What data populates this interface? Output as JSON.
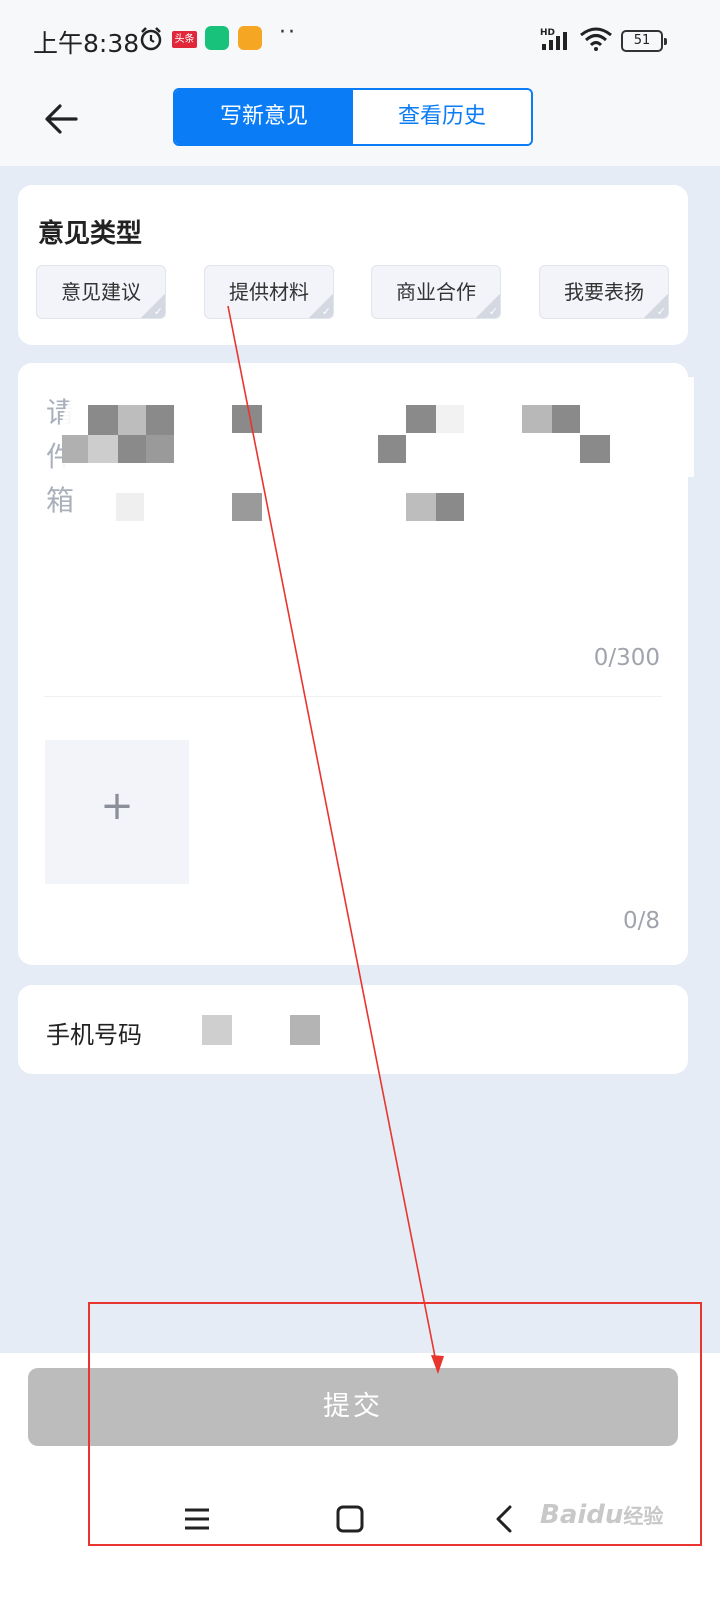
{
  "status_bar": {
    "time": "上午8:38",
    "news_badge": "头条",
    "more": "··",
    "hd": "HD",
    "battery": "51"
  },
  "header": {
    "tabs": [
      {
        "label": "写新意见",
        "active": true
      },
      {
        "label": "查看历史",
        "active": false
      }
    ]
  },
  "feedback_type": {
    "title": "意见类型",
    "options": [
      "意见建议",
      "提供材料",
      "商业合作",
      "我要表扬"
    ]
  },
  "content": {
    "placeholder_visible": [
      "请",
      "件",
      "箱"
    ],
    "char_count": "0/300",
    "upload_plus": "+",
    "image_count": "0/8"
  },
  "phone": {
    "label": "手机号码"
  },
  "submit_label": "提交",
  "watermark": {
    "brand": "Baidu",
    "suffix": "经验"
  },
  "colors": {
    "accent": "#0a7cf5",
    "submit_disabled": "#bcbcbc",
    "annotation": "#e8352f",
    "background": "#e6ecf5"
  }
}
